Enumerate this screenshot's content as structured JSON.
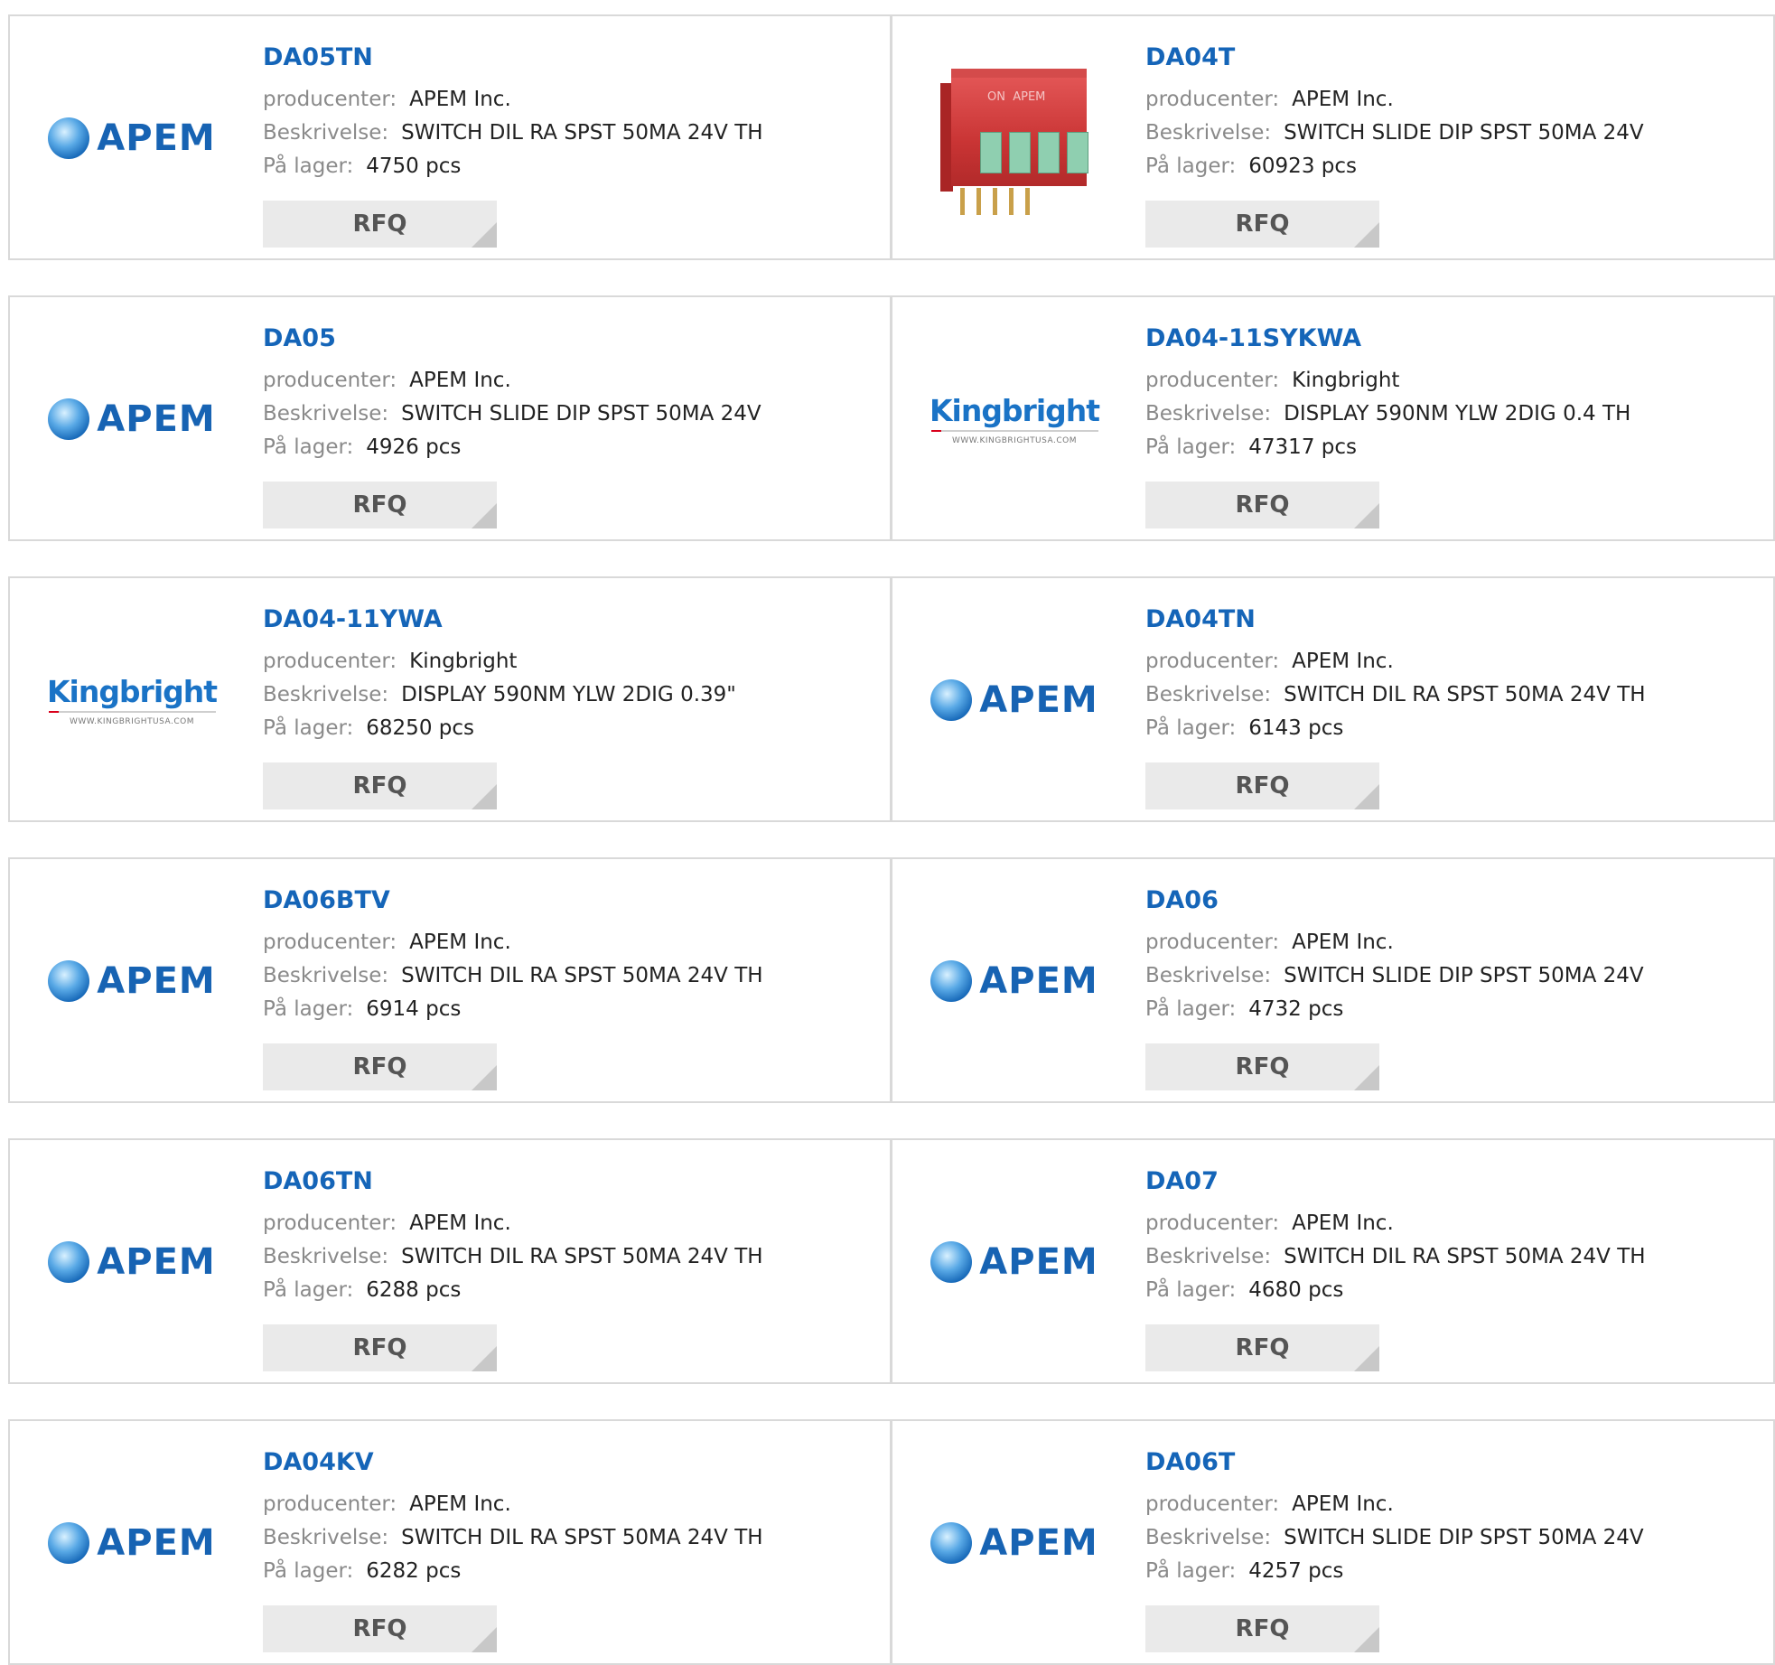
{
  "labels": {
    "producer": "producenter:",
    "description": "Beskrivelse:",
    "stock": "På lager:",
    "rfq": "RFQ"
  },
  "brand_logos": {
    "apem": {
      "text": "APEM",
      "color": "#1763b3"
    },
    "kingbright": {
      "text": "Kingbright",
      "url": "WWW.KINGBRIGHTUSA.COM",
      "color": "#1a73c6"
    }
  },
  "products": [
    {
      "part": "DA05TN",
      "producer": "APEM Inc.",
      "description": "SWITCH DIL RA SPST 50MA 24V TH",
      "stock": "4750 pcs",
      "logo": "apem"
    },
    {
      "part": "DA04T",
      "producer": "APEM Inc.",
      "description": "SWITCH SLIDE DIP SPST 50MA 24V",
      "stock": "60923 pcs",
      "logo": "photo"
    },
    {
      "part": "DA05",
      "producer": "APEM Inc.",
      "description": "SWITCH SLIDE DIP SPST 50MA 24V",
      "stock": "4926 pcs",
      "logo": "apem"
    },
    {
      "part": "DA04-11SYKWA",
      "producer": "Kingbright",
      "description": "DISPLAY 590NM YLW 2DIG 0.4 TH",
      "stock": "47317 pcs",
      "logo": "kingbright"
    },
    {
      "part": "DA04-11YWA",
      "producer": "Kingbright",
      "description": "DISPLAY 590NM YLW 2DIG 0.39\"",
      "stock": "68250 pcs",
      "logo": "kingbright"
    },
    {
      "part": "DA04TN",
      "producer": "APEM Inc.",
      "description": "SWITCH DIL RA SPST 50MA 24V TH",
      "stock": "6143 pcs",
      "logo": "apem"
    },
    {
      "part": "DA06BTV",
      "producer": "APEM Inc.",
      "description": "SWITCH DIL RA SPST 50MA 24V TH",
      "stock": "6914 pcs",
      "logo": "apem"
    },
    {
      "part": "DA06",
      "producer": "APEM Inc.",
      "description": "SWITCH SLIDE DIP SPST 50MA 24V",
      "stock": "4732 pcs",
      "logo": "apem"
    },
    {
      "part": "DA06TN",
      "producer": "APEM Inc.",
      "description": "SWITCH DIL RA SPST 50MA 24V TH",
      "stock": "6288 pcs",
      "logo": "apem"
    },
    {
      "part": "DA07",
      "producer": "APEM Inc.",
      "description": "SWITCH DIL RA SPST 50MA 24V TH",
      "stock": "4680 pcs",
      "logo": "apem"
    },
    {
      "part": "DA04KV",
      "producer": "APEM Inc.",
      "description": "SWITCH DIL RA SPST 50MA 24V TH",
      "stock": "6282 pcs",
      "logo": "apem"
    },
    {
      "part": "DA06T",
      "producer": "APEM Inc.",
      "description": "SWITCH SLIDE DIP SPST 50MA 24V",
      "stock": "4257 pcs",
      "logo": "apem"
    }
  ]
}
